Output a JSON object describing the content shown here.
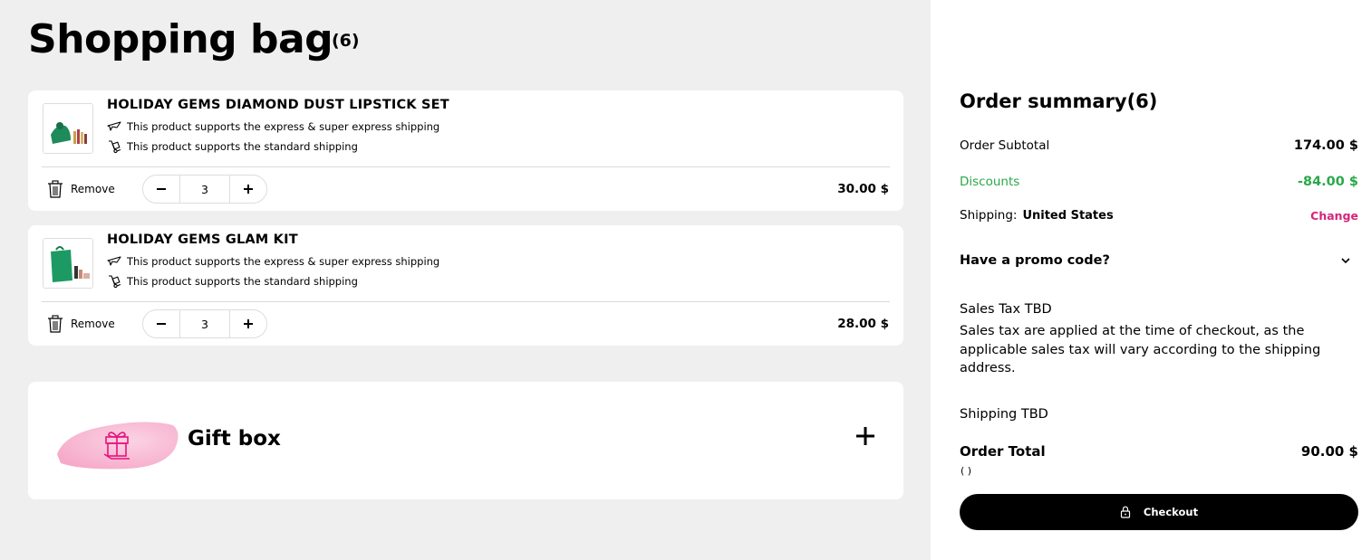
{
  "bag": {
    "title": "Shopping bag",
    "count": "(6)"
  },
  "items": [
    {
      "name": "HOLIDAY GEMS DIAMOND DUST LIPSTICK SET",
      "ship_express": "This product supports the express & super express shipping",
      "ship_standard": "This product supports the standard shipping",
      "remove_label": "Remove",
      "quantity": "3",
      "price": "30.00 $",
      "thumb_color": "#1f8a5a"
    },
    {
      "name": "HOLIDAY GEMS GLAM KIT",
      "ship_express": "This product supports the express & super express shipping",
      "ship_standard": "This product supports the standard shipping",
      "remove_label": "Remove",
      "quantity": "3",
      "price": "28.00 $",
      "thumb_color": "#1d9a63"
    }
  ],
  "gift": {
    "label": "Gift box",
    "accent": "#e8127c"
  },
  "summary": {
    "title": "Order summary(6)",
    "subtotal_label": "Order Subtotal",
    "subtotal_value": "174.00 $",
    "discount_label": "Discounts",
    "discount_value": "-84.00 $",
    "shipping_label": "Shipping:",
    "shipping_country": "United States",
    "change_label": "Change",
    "promo_label": "Have a promo code?",
    "tax_title": "Sales Tax TBD",
    "tax_desc": "Sales tax are applied at the time of checkout, as the applicable sales tax will vary according to the shipping address.",
    "shipping_tbd": "Shipping TBD",
    "total_label": "Order Total",
    "total_value": "90.00 $",
    "total_note": "( )",
    "checkout_label": "Checkout"
  },
  "colors": {
    "discount": "#2aa84a",
    "link": "#d6247a",
    "background": "#efefef"
  }
}
